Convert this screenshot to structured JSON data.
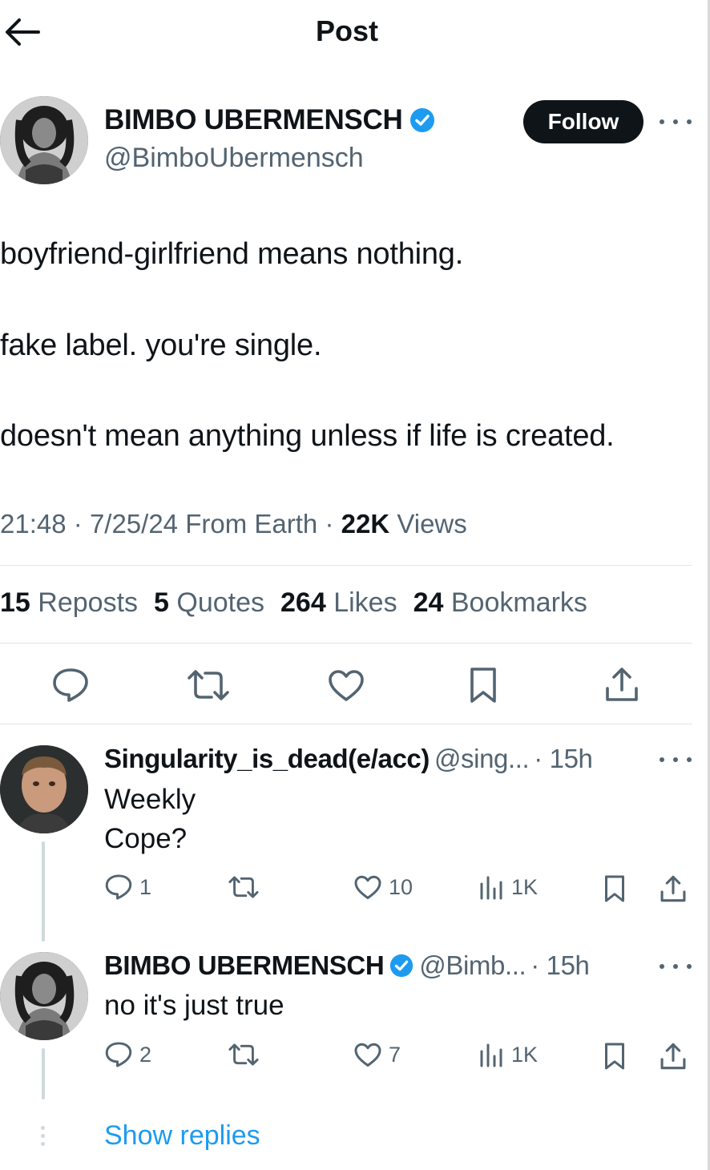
{
  "header": {
    "title": "Post"
  },
  "post": {
    "author": {
      "name": "BIMBO UBERMENSCH",
      "handle": "@BimboUbermensch",
      "verified": true
    },
    "follow_label": "Follow",
    "lines": [
      "boyfriend-girlfriend means nothing.",
      "fake label. you're single.",
      "doesn't mean anything unless if life is created."
    ],
    "meta": {
      "time": "21:48",
      "date": "7/25/24",
      "location": "From Earth",
      "views_count": "22K",
      "views_label": "Views",
      "sep": "·"
    },
    "stats": {
      "reposts_count": "15",
      "reposts_label": "Reposts",
      "quotes_count": "5",
      "quotes_label": "Quotes",
      "likes_count": "264",
      "likes_label": "Likes",
      "bookmarks_count": "24",
      "bookmarks_label": "Bookmarks"
    },
    "actions": [
      "reply",
      "repost",
      "like",
      "bookmark",
      "share"
    ]
  },
  "replies": [
    {
      "name": "Singularity_is_dead(e/acc)",
      "handle": "@sing...",
      "time": "· 15h",
      "verified": false,
      "lines": [
        "Weekly",
        "Cope?"
      ],
      "reply_count": "1",
      "like_count": "10",
      "view_count": "1K"
    },
    {
      "name": "BIMBO UBERMENSCH",
      "handle": "@Bimb...",
      "time": "· 15h",
      "verified": true,
      "lines": [
        "no it's just true"
      ],
      "reply_count": "2",
      "like_count": "7",
      "view_count": "1K"
    }
  ],
  "show_replies_label": "Show replies",
  "colors": {
    "accent": "#1d9bf0",
    "text": "#0f1419",
    "muted": "#536471",
    "divider": "#e1e6ea",
    "follow_bg": "#0f1419"
  }
}
